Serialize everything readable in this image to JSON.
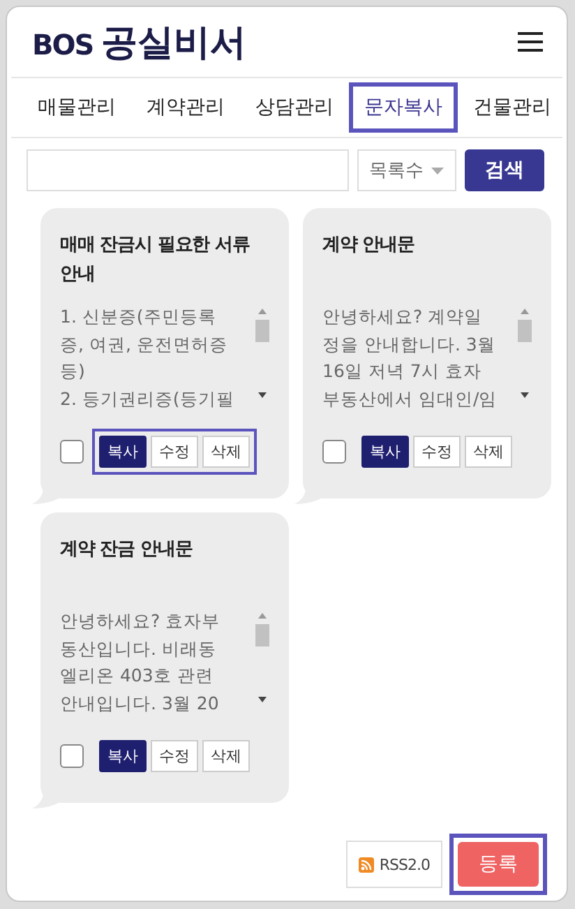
{
  "logo": {
    "latin": "BOS",
    "korean": "공실비서"
  },
  "tabs": [
    {
      "label": "매물관리",
      "selected": false
    },
    {
      "label": "계약관리",
      "selected": false
    },
    {
      "label": "상담관리",
      "selected": false
    },
    {
      "label": "문자복사",
      "selected": true
    },
    {
      "label": "건물관리",
      "selected": false
    }
  ],
  "search": {
    "select": "목록수",
    "button": "검색"
  },
  "cards": [
    {
      "title": "매매 잔금시 필요한 서류 안내",
      "lines": [
        "1. 신분증(주민등록",
        "증, 여권, 운전면허증",
        "등)",
        "2. 등기권리증(등기필"
      ],
      "checked": false,
      "buttons_highlighted": true,
      "buttons": [
        "복사",
        "수정",
        "삭제"
      ]
    },
    {
      "title": "계약 안내문",
      "lines": [
        "안녕하세요? 계약일",
        "정을 안내합니다. 3월",
        "16일 저녁 7시 효자",
        "부동산에서 임대인/임"
      ],
      "checked": false,
      "buttons_highlighted": false,
      "buttons": [
        "복사",
        "수정",
        "삭제"
      ]
    },
    {
      "title": "계약 잔금 안내문",
      "lines": [
        "안녕하세요? 효자부",
        "동산입니다. 비래동",
        "엘리온 403호 관련",
        "안내입니다. 3월 20"
      ],
      "checked": false,
      "buttons_highlighted": false,
      "buttons": [
        "복사",
        "수정",
        "삭제"
      ]
    }
  ],
  "footer": {
    "rss": "RSS2.0",
    "register": "등록",
    "register_highlighted": true
  }
}
